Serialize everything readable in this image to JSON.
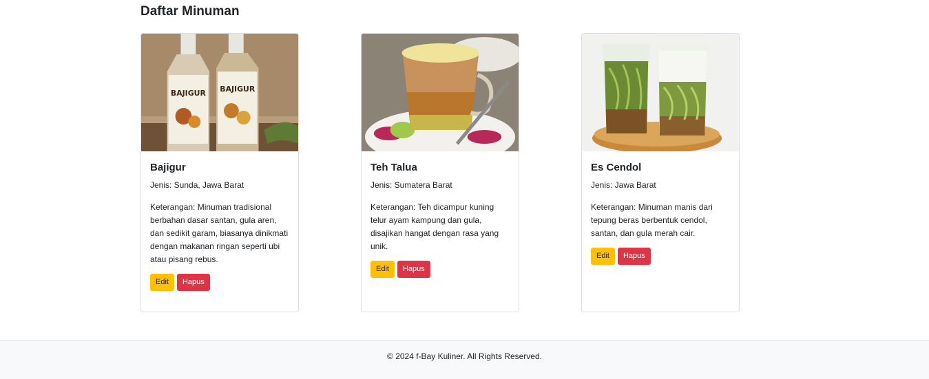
{
  "section": {
    "title": "Daftar Minuman"
  },
  "drinks": [
    {
      "name": "Bajigur",
      "jenis": "Jenis: Sunda, Jawa Barat",
      "keterangan": "Keterangan: Minuman tradisional berbahan dasar santan, gula aren, dan sedikit garam, biasanya dinikmati dengan makanan ringan seperti ubi atau pisang rebus.",
      "image_label": "BAJIGUR"
    },
    {
      "name": "Teh Talua",
      "jenis": "Jenis: Sumatera Barat",
      "keterangan": "Keterangan: Teh dicampur kuning telur ayam kampung dan gula, disajikan hangat dengan rasa yang unik."
    },
    {
      "name": "Es Cendol",
      "jenis": "Jenis: Jawa Barat",
      "keterangan": "Keterangan: Minuman manis dari tepung beras berbentuk cendol, santan, dan gula merah cair."
    }
  ],
  "buttons": {
    "edit": "Edit",
    "delete": "Hapus"
  },
  "footer": {
    "text": "© 2024 f-Bay Kuliner. All Rights Reserved."
  },
  "colors": {
    "edit": "#ffc107",
    "delete": "#dc3545",
    "footer_bg": "#f8f9fa"
  }
}
